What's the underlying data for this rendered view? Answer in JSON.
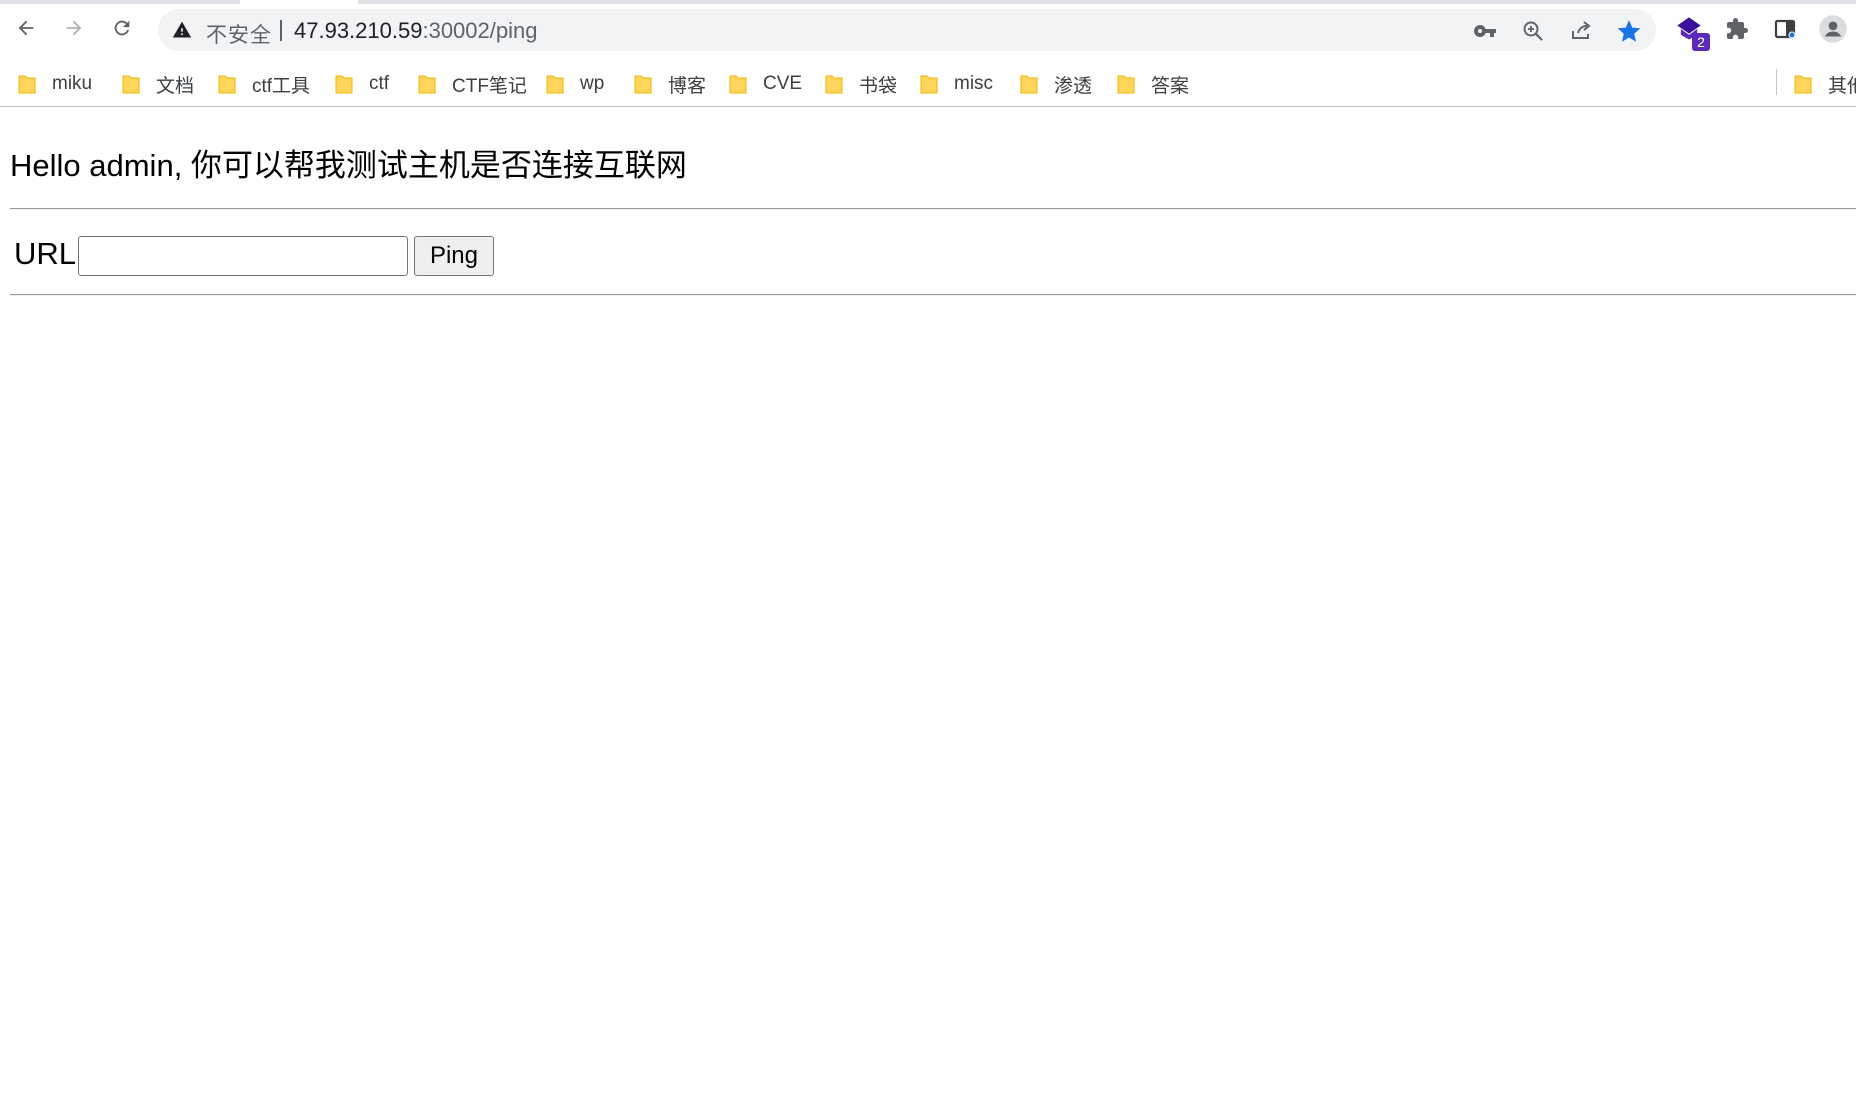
{
  "browser": {
    "security_label": "不安全",
    "url_host": "47.93.210.59",
    "url_path": ":30002/ping",
    "extension_badge_count": "2",
    "icons": {
      "back": "back-arrow-icon",
      "forward": "forward-arrow-icon",
      "reload": "reload-icon",
      "warning": "warning-triangle-icon",
      "password": "key-icon",
      "zoom": "zoom-icon",
      "share": "share-icon",
      "bookmark": "star-icon",
      "extension": "extension-icon",
      "puzzle": "puzzle-icon",
      "sidepanel": "side-panel-icon",
      "profile": "profile-icon"
    },
    "accent_color": "#1a73e8"
  },
  "bookmarks": {
    "items": [
      {
        "label": "miku"
      },
      {
        "label": "文档"
      },
      {
        "label": "ctf工具"
      },
      {
        "label": "ctf"
      },
      {
        "label": "CTF笔记"
      },
      {
        "label": "wp"
      },
      {
        "label": "博客"
      },
      {
        "label": "CVE"
      },
      {
        "label": "书袋"
      },
      {
        "label": "misc"
      },
      {
        "label": "渗透"
      },
      {
        "label": "答案"
      }
    ],
    "overflow_label": "其他"
  },
  "page": {
    "greeting": "Hello admin, 你可以帮我测试主机是否连接互联网",
    "url_label": "URL",
    "url_value": "",
    "ping_button_label": "Ping"
  }
}
